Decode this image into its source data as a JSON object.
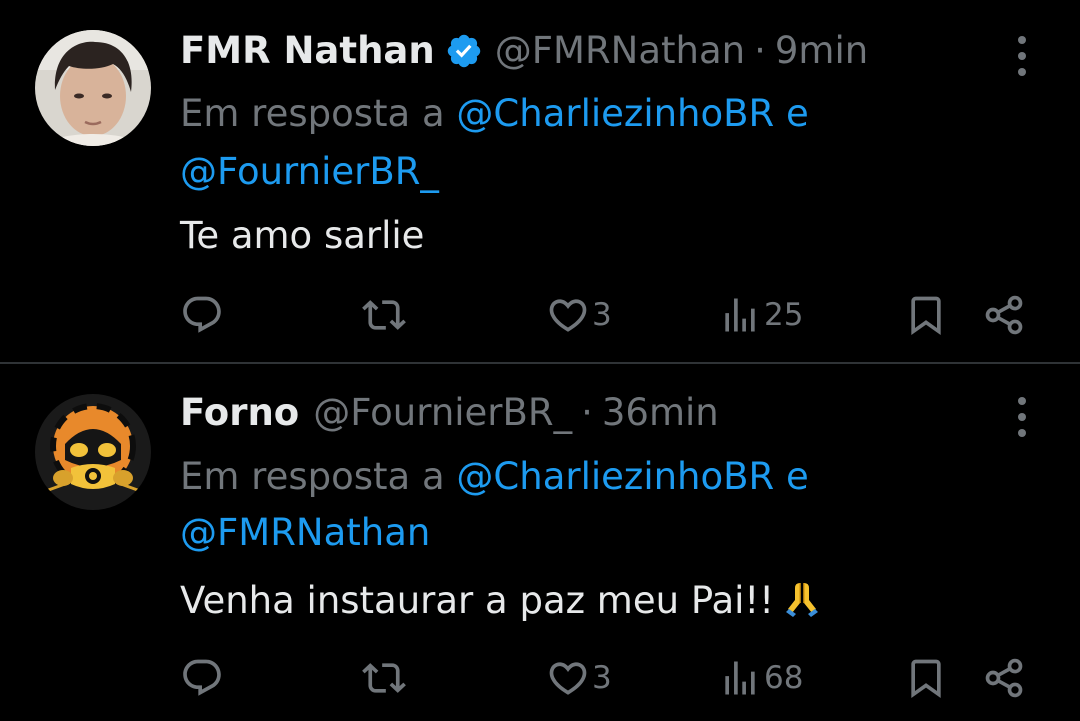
{
  "tweets": [
    {
      "name": "FMR Nathan",
      "verified": true,
      "handle": "@FMRNathan",
      "separator": "·",
      "time": "9min",
      "reply_prefix": "Em resposta a",
      "reply_user1": "@CharliezinhoBR",
      "reply_conj": "e",
      "reply_user2": "@FournierBR_",
      "text": "Te amo sarlie",
      "likes": "3",
      "views": "25"
    },
    {
      "name": "Forno",
      "verified": false,
      "handle": "@FournierBR_",
      "separator": "·",
      "time": "36min",
      "reply_prefix": "Em resposta a",
      "reply_user1": "@CharliezinhoBR",
      "reply_conj": "e",
      "reply_user2": "@FMRNathan",
      "text": "Venha instaurar a paz meu Pai!!",
      "emoji": "folded-hands",
      "likes": "3",
      "views": "68"
    }
  ],
  "colors": {
    "background": "#000000",
    "text": "#e7e9ea",
    "secondary": "#71767b",
    "link": "#1d9bf0",
    "divider": "#2f3336"
  }
}
